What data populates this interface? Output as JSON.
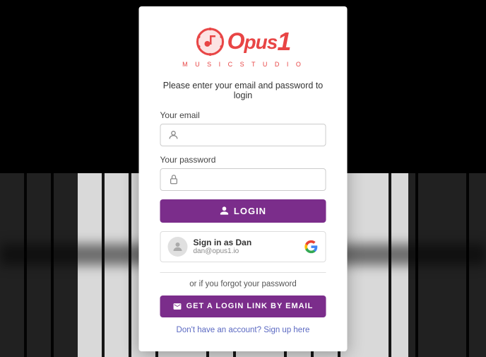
{
  "app": {
    "name": "Opus1 Music Studio",
    "logo_text_opus": "pus",
    "logo_text_number": "1",
    "logo_subtitle": "M U S I C   S T U D I O"
  },
  "login": {
    "subtitle": "Please enter your email and password to login",
    "email_label": "Your email",
    "email_placeholder": "",
    "password_label": "Your password",
    "password_placeholder": "",
    "login_button": "LOGIN",
    "google_signin_name": "Sign in as Dan",
    "google_signin_email": "dan@opus1.io",
    "forgot_text": "or if you forgot your password",
    "email_link_button": "GET A LOGIN LINK BY EMAIL",
    "signup_text": "Don't have an account? Sign up here"
  }
}
